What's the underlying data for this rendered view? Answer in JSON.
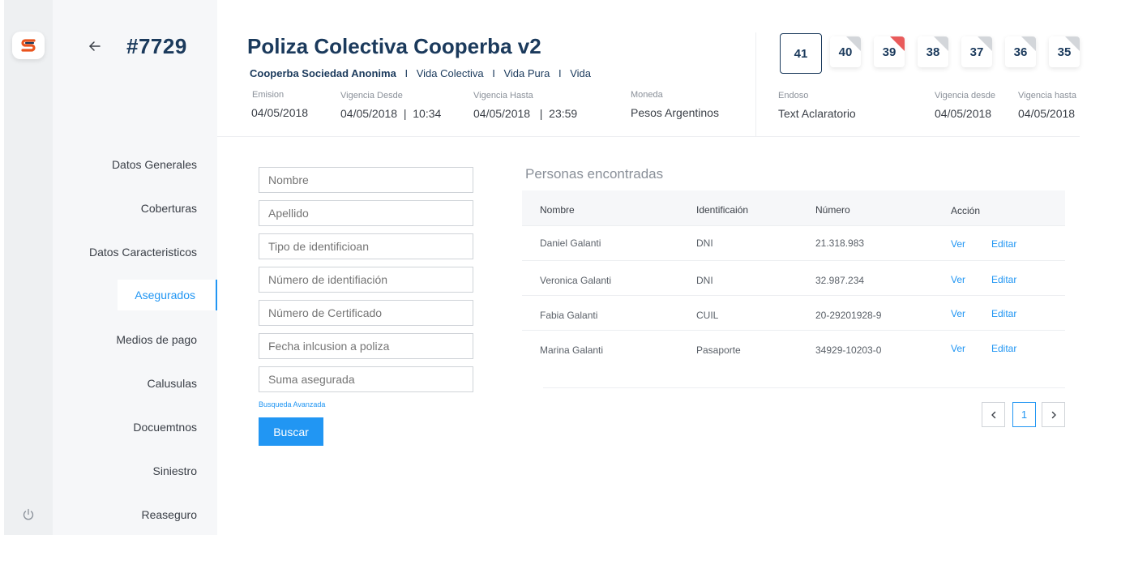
{
  "app": {
    "logo_letter": "S",
    "brand_color": "#2196f3",
    "accent_dark": "#1b3a5c",
    "logo_color": "#e9541d"
  },
  "policy": {
    "number": "#7729",
    "title": "Poliza Colectiva Cooperba v2"
  },
  "subline": {
    "company": "Cooperba Sociedad Anonima",
    "separator": "I",
    "items": [
      "Vida Colectiva",
      "Vida Pura",
      "Vida"
    ]
  },
  "meta": [
    {
      "label": "Emision",
      "value": "04/05/2018"
    },
    {
      "label": "Vigencia Desde",
      "value": "04/05/2018  |  10:34"
    },
    {
      "label": "Vigencia Hasta",
      "value": "04/05/2018   |  23:59"
    },
    {
      "label": "Moneda",
      "value": "Pesos Argentinos"
    }
  ],
  "endoso_meta": [
    {
      "label": "Endoso",
      "value": "Text Aclaratorio"
    },
    {
      "label": "Vigencia desde",
      "value": "04/05/2018"
    },
    {
      "label": "Vigencia hasta",
      "value": "04/05/2018"
    }
  ],
  "endosos": [
    {
      "num": "41",
      "selected": true,
      "flag": "none"
    },
    {
      "num": "40",
      "selected": false,
      "flag": "grey"
    },
    {
      "num": "39",
      "selected": false,
      "flag": "red"
    },
    {
      "num": "38",
      "selected": false,
      "flag": "grey"
    },
    {
      "num": "37",
      "selected": false,
      "flag": "grey"
    },
    {
      "num": "36",
      "selected": false,
      "flag": "grey"
    },
    {
      "num": "35",
      "selected": false,
      "flag": "grey"
    }
  ],
  "nav": {
    "items": [
      "Datos Generales",
      "Coberturas",
      "Datos Caracteristicos",
      "Asegurados",
      "Medios de pago",
      "Calusulas",
      "Docuemtnos",
      "Siniestro",
      "Reaseguro"
    ],
    "active": "Asegurados"
  },
  "form": {
    "placeholders": [
      "Nombre",
      "Apellido",
      "Tipo de identificioan",
      "Número de identifiación",
      "Número de Certificado",
      "Fecha inlcusion a poliza",
      "Suma asegurada"
    ],
    "advanced_link": "Busqueda Avanzada",
    "search_button": "Buscar"
  },
  "results": {
    "title": "Personas encontradas",
    "columns": [
      "Nombre",
      "Identificaión",
      "Número",
      "Acción"
    ],
    "rows": [
      {
        "nombre": "Daniel Galanti",
        "tipo": "DNI",
        "numero": "21.318.983",
        "ver": "Ver",
        "editar": "Editar"
      },
      {
        "nombre": "Veronica Galanti",
        "tipo": "DNI",
        "numero": "32.987.234",
        "ver": "Ver",
        "editar": "Editar"
      },
      {
        "nombre": "Fabia Galanti",
        "tipo": "CUIL",
        "numero": "20-29201928-9",
        "ver": "Ver",
        "editar": "Editar"
      },
      {
        "nombre": "Marina Galanti",
        "tipo": "Pasaporte",
        "numero": "34929-10203-0",
        "ver": "Ver",
        "editar": "Editar"
      }
    ]
  },
  "pagination": {
    "current": "1"
  }
}
